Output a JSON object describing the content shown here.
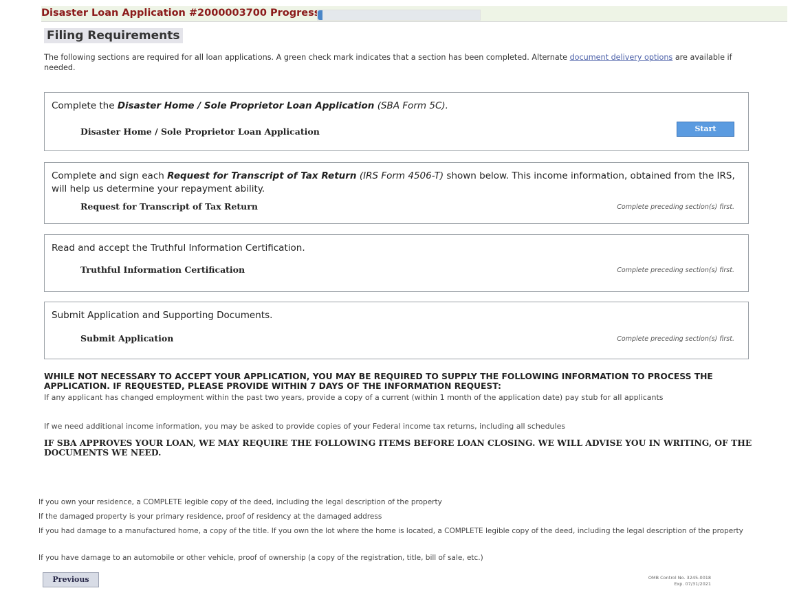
{
  "header": {
    "title": "Disaster Loan Application #2000003700 Progress",
    "progress_fraction": 0.03,
    "progress_color": "#4a86c8"
  },
  "page_title": "Filing Requirements",
  "intro": {
    "text": "The following sections are required for all loan applications. A green check mark indicates that a section has been completed. Alternate",
    "link": "document delivery options",
    "suffix": "are available if needed."
  },
  "sections": [
    {
      "lead_prefix": "Complete the",
      "lead_emphasis": "Disaster Home / Sole Proprietor Loan Application",
      "lead_form": "(SBA Form 5C).",
      "lead_suffix": "",
      "item": "Disaster Home / Sole Proprietor Loan Application",
      "action": "Start"
    },
    {
      "lead_prefix": "Complete and sign each",
      "lead_emphasis": "Request for Transcript of Tax Return",
      "lead_form": "(IRS Form 4506-T)",
      "lead_suffix": "shown below. This income information, obtained from the IRS, will help us determine your repayment ability.",
      "item": "Request for Transcript of Tax Return",
      "status": "Complete preceding section(s) first."
    },
    {
      "lead": "Read and accept the Truthful Information Certification.",
      "item": "Truthful Information Certification",
      "status": "Complete preceding section(s) first."
    },
    {
      "lead": "Submit Application and Supporting Documents.",
      "item": "Submit Application",
      "status": "Complete preceding section(s) first."
    }
  ],
  "notices": {
    "heading_1": "WHILE NOT NECESSARY TO ACCEPT YOUR APPLICATION, YOU MAY BE REQUIRED TO SUPPLY THE FOLLOWING INFORMATION TO PROCESS THE APPLICATION. IF REQUESTED, PLEASE PROVIDE WITHIN 7 DAYS OF THE INFORMATION REQUEST:",
    "line_1": "If any applicant has changed employment within the past two years, provide a copy of a current (within 1 month of the application date) pay stub for all applicants",
    "line_2": "If we need additional income information, you may be asked to provide copies of your Federal income tax returns, including all schedules",
    "heading_2": "IF SBA APPROVES YOUR LOAN, WE MAY REQUIRE THE FOLLOWING ITEMS BEFORE LOAN CLOSING. WE WILL ADVISE YOU IN WRITING, OF THE DOCUMENTS WE NEED."
  },
  "closing_docs": [
    "If you own your residence, a COMPLETE legible copy of the deed, including the legal description of the property",
    "If the damaged property is your primary residence, proof of residency at the damaged address",
    "If you had damage to a manufactured home, a copy of the title. If you own the lot where the home is located, a COMPLETE legible copy of the deed, including the legal description of the property",
    "If you have damage to an automobile or other vehicle, proof of ownership (a copy of the registration, title, bill of sale, etc.)"
  ],
  "footer": {
    "previous_label": "Previous",
    "omb_control": "OMB Control No. 3245-0018",
    "omb_exp": "Exp. 07/31/2021"
  }
}
